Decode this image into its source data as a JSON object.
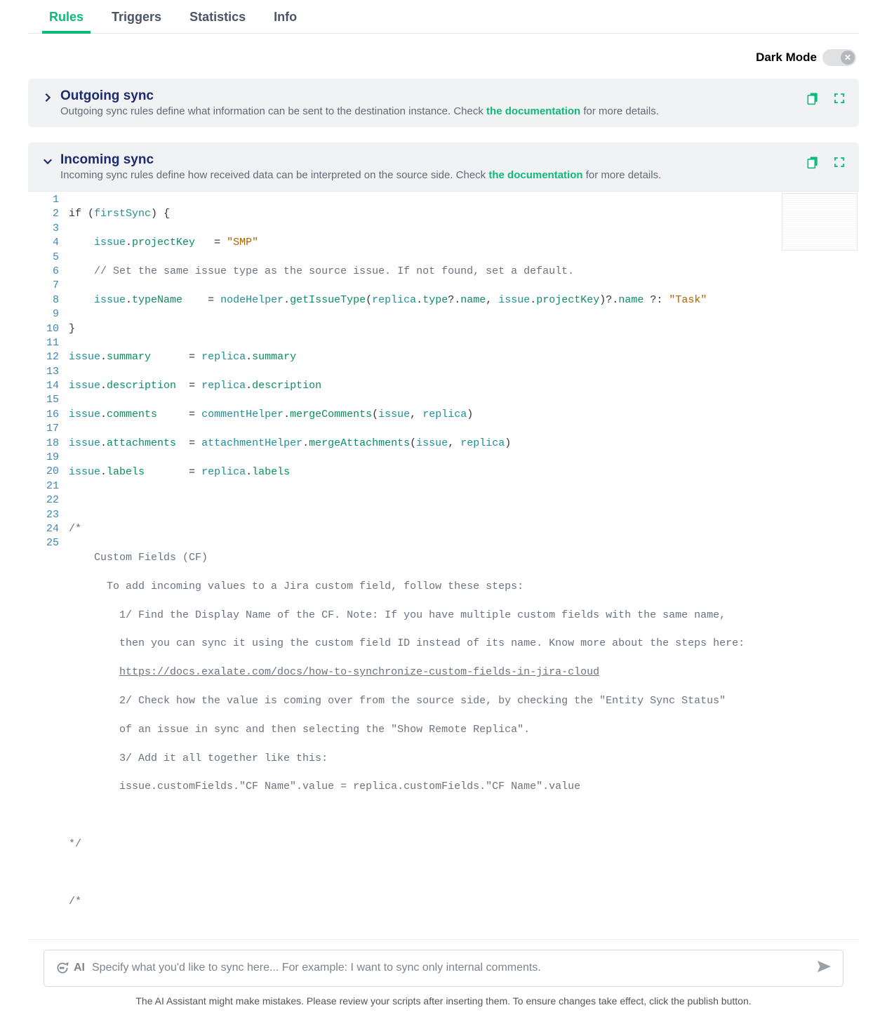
{
  "tabs": {
    "rules": "Rules",
    "triggers": "Triggers",
    "statistics": "Statistics",
    "info": "Info"
  },
  "dark_mode": {
    "label": "Dark Mode",
    "state": false
  },
  "outgoing": {
    "title": "Outgoing sync",
    "sub_pre": "Outgoing sync rules define what information can be sent to the destination instance. Check ",
    "doc": "the documentation",
    "sub_post": " for more details."
  },
  "incoming": {
    "title": "Incoming sync",
    "sub_pre": "Incoming sync rules define how received data can be interpreted on the source side. Check ",
    "doc": "the documentation",
    "sub_post": " for more details."
  },
  "code": {
    "l1_a": "if",
    "l1_b": " (",
    "l1_c": "firstSync",
    "l1_d": ") {",
    "l2_a": "issue",
    "l2_b": ".",
    "l2_c": "projectKey",
    "l2_d": "   = ",
    "l2_e": "\"SMP\"",
    "l3": "// Set the same issue type as the source issue. If not found, set a default.",
    "l4_a": "issue",
    "l4_b": ".",
    "l4_c": "typeName",
    "l4_d": "    = ",
    "l4_e": "nodeHelper",
    "l4_f": ".",
    "l4_g": "getIssueType",
    "l4_h": "(",
    "l4_i": "replica",
    "l4_j": ".",
    "l4_k": "type",
    "l4_l": "?.",
    "l4_m": "name",
    "l4_n": ", ",
    "l4_o": "issue",
    "l4_p": ".",
    "l4_q": "projectKey",
    "l4_r": ")?.",
    "l4_s": "name",
    "l4_t": " ?:",
    "l4_u": " \"Task\"",
    "l5": "}",
    "l6_a": "issue",
    "l6_b": ".",
    "l6_c": "summary",
    "l6_d": "      = ",
    "l6_e": "replica",
    "l6_f": ".",
    "l6_g": "summary",
    "l7_a": "issue",
    "l7_b": ".",
    "l7_c": "description",
    "l7_d": "  = ",
    "l7_e": "replica",
    "l7_f": ".",
    "l7_g": "description",
    "l8_a": "issue",
    "l8_b": ".",
    "l8_c": "comments",
    "l8_d": "     = ",
    "l8_e": "commentHelper",
    "l8_f": ".",
    "l8_g": "mergeComments",
    "l8_h": "(",
    "l8_i": "issue",
    "l8_j": ", ",
    "l8_k": "replica",
    "l8_l": ")",
    "l9_a": "issue",
    "l9_b": ".",
    "l9_c": "attachments",
    "l9_d": "  = ",
    "l9_e": "attachmentHelper",
    "l9_f": ".",
    "l9_g": "mergeAttachments",
    "l9_h": "(",
    "l9_i": "issue",
    "l9_j": ", ",
    "l9_k": "replica",
    "l9_l": ")",
    "l10_a": "issue",
    "l10_b": ".",
    "l10_c": "labels",
    "l10_d": "       = ",
    "l10_e": "replica",
    "l10_f": ".",
    "l10_g": "labels",
    "l12": "/*",
    "l13": "Custom Fields (CF)",
    "l14": "To add incoming values to a Jira custom field, follow these steps:",
    "l15": "1/ Find the Display Name of the CF. Note: If you have multiple custom fields with the same name,",
    "l16": "then you can sync it using the custom field ID instead of its name. Know more about the steps here:",
    "l17": "https://docs.exalate.com/docs/how-to-synchronize-custom-fields-in-jira-cloud",
    "l18": "2/ Check how the value is coming over from the source side, by checking the \"Entity Sync Status\"",
    "l19": "of an issue in sync and then selecting the \"Show Remote Replica\".",
    "l20": "3/ Add it all together like this:",
    "l21": "issue.customFields.\"CF Name\".value = replica.customFields.\"CF Name\".value",
    "l23": "*/",
    "l25": "/*"
  },
  "lines": [
    "1",
    "2",
    "3",
    "4",
    "5",
    "6",
    "7",
    "8",
    "9",
    "10",
    "11",
    "12",
    "13",
    "14",
    "15",
    "16",
    "17",
    "18",
    "19",
    "20",
    "21",
    "22",
    "23",
    "24",
    "25"
  ],
  "ai": {
    "lead": "AI",
    "placeholder": "Specify what you'd like to sync here...  For example: I want to sync only internal comments.",
    "disclaimer": "The AI Assistant might make mistakes. Please review your scripts after inserting them. To ensure changes take effect, click the publish button."
  }
}
